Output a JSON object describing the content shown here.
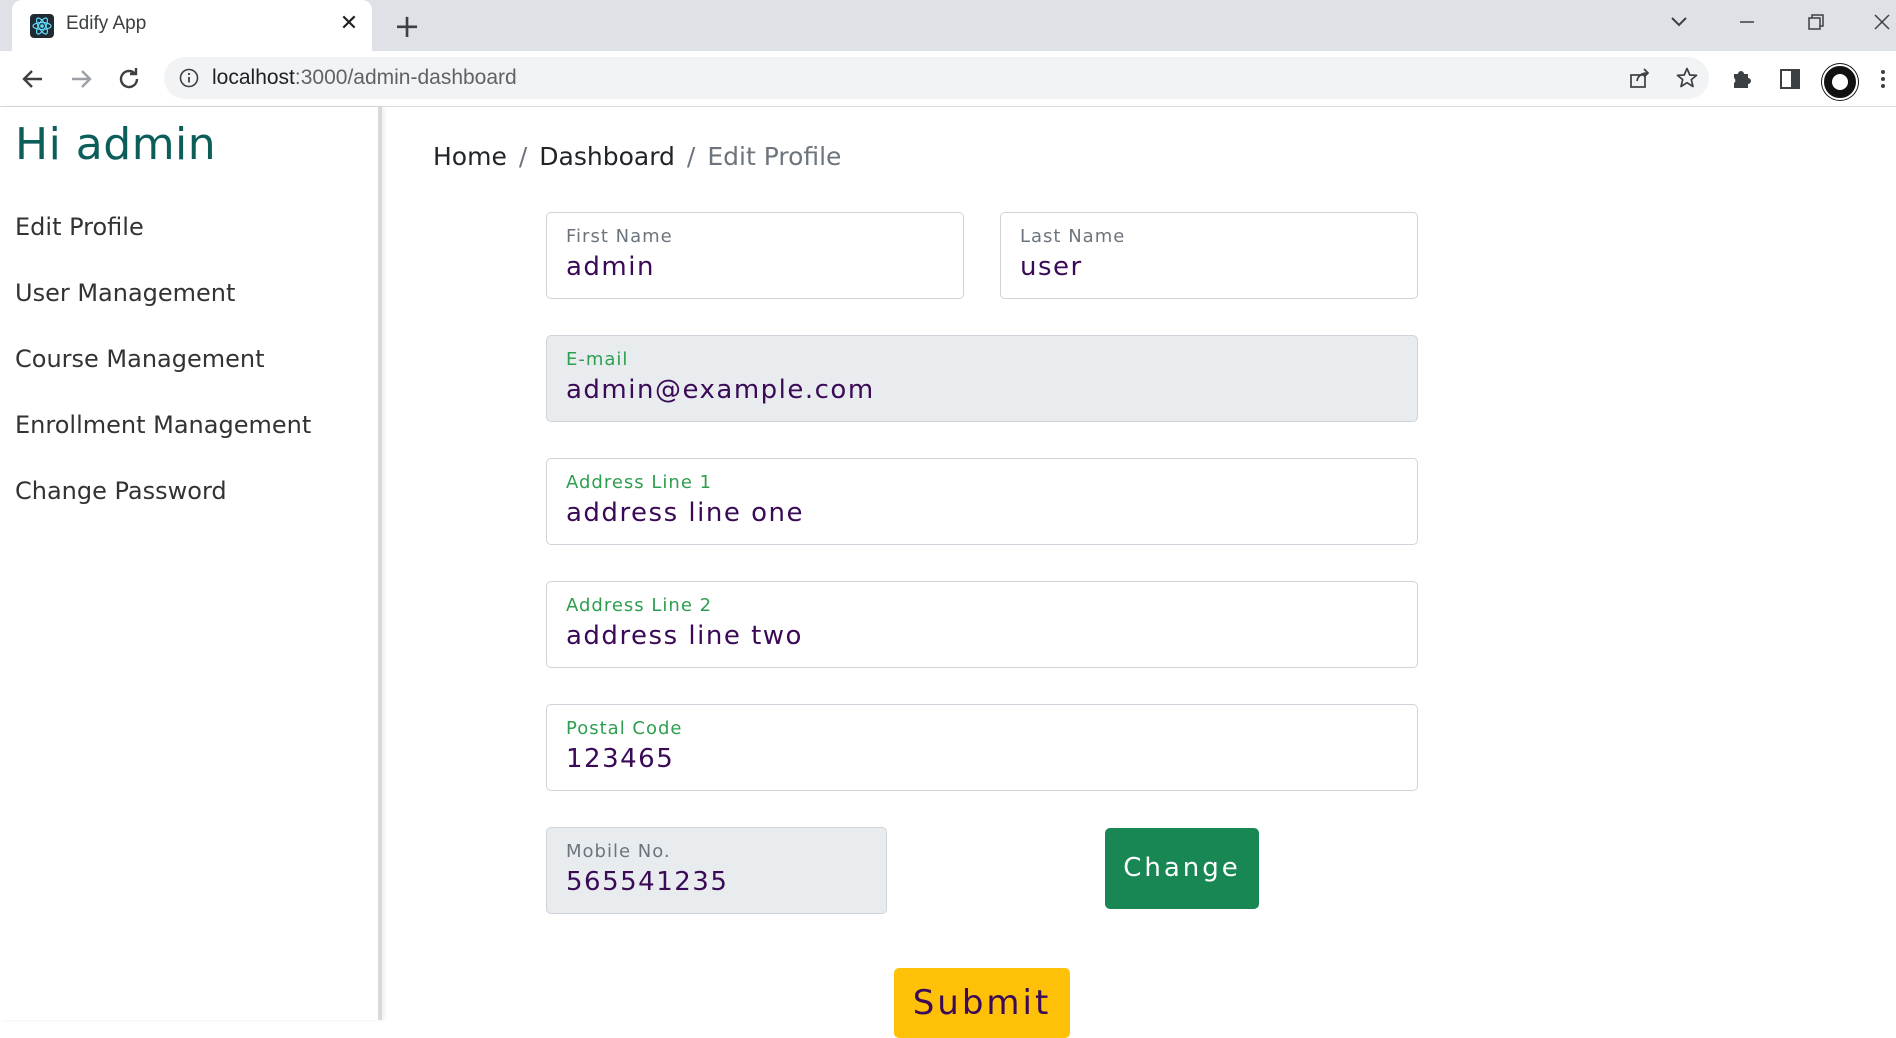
{
  "browser": {
    "tab_title": "Edify App",
    "url_host": "localhost",
    "url_path": ":3000/admin-dashboard"
  },
  "sidebar": {
    "greeting": "Hi admin",
    "items": [
      {
        "label": "Edit Profile"
      },
      {
        "label": "User Management"
      },
      {
        "label": "Course Management"
      },
      {
        "label": "Enrollment Management"
      },
      {
        "label": "Change Password"
      }
    ]
  },
  "breadcrumb": {
    "home": "Home",
    "dashboard": "Dashboard",
    "current": "Edit Profile"
  },
  "form": {
    "first_name": {
      "label": "First Name",
      "value": "admin"
    },
    "last_name": {
      "label": "Last Name",
      "value": "user"
    },
    "email": {
      "label": "E-mail",
      "value": "admin@example.com"
    },
    "address1": {
      "label": "Address Line 1",
      "value": "address line one"
    },
    "address2": {
      "label": "Address Line 2",
      "value": "address line two"
    },
    "postal": {
      "label": "Postal Code",
      "value": "123465"
    },
    "mobile": {
      "label": "Mobile No.",
      "value": "565541235"
    },
    "change_label": "Change",
    "submit_label": "Submit"
  },
  "colors": {
    "accent_green": "#198754",
    "submit_yellow": "#ffc107",
    "title_teal": "#0b5e5a",
    "value_purple": "#3b0a57"
  }
}
